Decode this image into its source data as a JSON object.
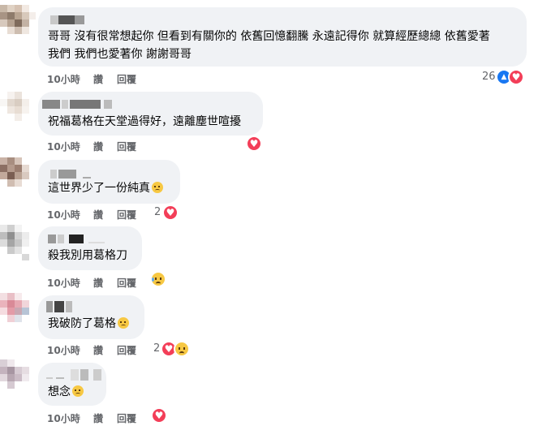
{
  "comments": [
    {
      "text_lines": [
        "哥哥 沒有很常想起你 但看到有關你的 依舊回憶翻騰 永遠記得你 就算經歷總總 依舊愛著",
        "我們 我們也愛著你 謝謝哥哥"
      ],
      "time": "10小時",
      "like": "讚",
      "reply": "回覆",
      "reaction_count": "26",
      "reactions": [
        "like-icon",
        "heart-icon"
      ]
    },
    {
      "text_lines": [
        "祝福葛格在天堂過得好，遠離塵世喧擾"
      ],
      "time": "10小時",
      "like": "讚",
      "reply": "回覆",
      "reaction_count": "",
      "reactions": [
        "heart-icon"
      ]
    },
    {
      "text_lines": [
        "這世界少了一份純真"
      ],
      "emoji": "crying-face-icon",
      "time": "10小時",
      "like": "讚",
      "reply": "回覆",
      "reaction_count": "2",
      "reactions": [
        "heart-icon"
      ]
    },
    {
      "text_lines": [
        "殺我別用葛格刀"
      ],
      "time": "10小時",
      "like": "讚",
      "reply": "回覆",
      "reaction_count": "",
      "reactions": [
        "sad-face-icon"
      ]
    },
    {
      "text_lines": [
        "我破防了葛格"
      ],
      "emoji": "crying-face-icon",
      "time": "10小時",
      "like": "讚",
      "reply": "回覆",
      "reaction_count": "2",
      "reactions": [
        "heart-icon",
        "sad-face-icon"
      ]
    },
    {
      "text_lines": [
        "想念"
      ],
      "emoji": "pensive-face-icon",
      "time": "10小時",
      "like": "讚",
      "reply": "回覆",
      "reaction_count": "",
      "reactions": [
        "heart-icon"
      ]
    }
  ],
  "colors": {
    "bubble": "#f0f2f5",
    "meta_text": "#65676b",
    "like_blue": "#1877f2",
    "heart_red": "#f33e58"
  }
}
